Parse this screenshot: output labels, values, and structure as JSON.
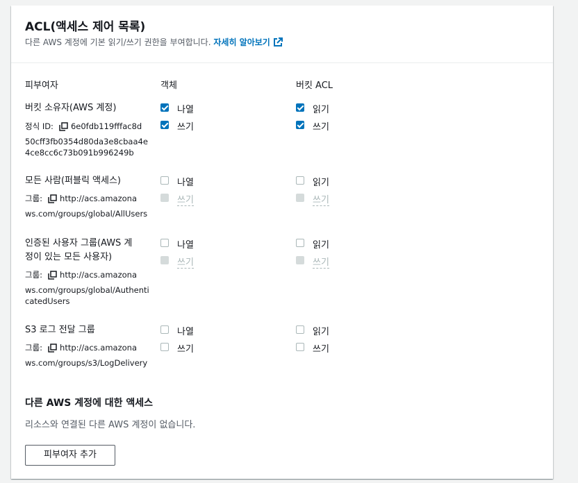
{
  "header": {
    "title": "ACL(액세스 제어 목록)",
    "description": "다른 AWS 계정에 기본 읽기/쓰기 권한을 부여합니다.",
    "learn_more": "자세히 알아보기"
  },
  "columns": {
    "grantee": "피부여자",
    "object": "객체",
    "bucket_acl": "버킷 ACL"
  },
  "grantees": [
    {
      "name": "버킷 소유자(AWS 계정)",
      "id_label": "정식 ID:",
      "id_lines": [
        "6e0fdb119fffac8d",
        "50cff3fb0354d80da3e8cbaa4e",
        "4ce8cc6c73b091b996249b"
      ],
      "object": {
        "list_label": "나열",
        "list_checked": true,
        "write_label": "쓰기",
        "write_checked": true,
        "write_disabled": false
      },
      "acl": {
        "read_label": "읽기",
        "read_checked": true,
        "write_label": "쓰기",
        "write_checked": true,
        "write_disabled": false
      }
    },
    {
      "name": "모든 사람(퍼블릭 액세스)",
      "id_label": "그룹:",
      "id_lines": [
        "http://acs.amazona",
        "ws.com/groups/global/AllUsers"
      ],
      "object": {
        "list_label": "나열",
        "list_checked": false,
        "write_label": "쓰기",
        "write_checked": false,
        "write_disabled": true
      },
      "acl": {
        "read_label": "읽기",
        "read_checked": false,
        "write_label": "쓰기",
        "write_checked": false,
        "write_disabled": true
      }
    },
    {
      "name_lines": [
        "인증된 사용자 그룹(AWS 계",
        "정이 있는 모든 사용자)"
      ],
      "id_label": "그룹:",
      "id_lines": [
        "http://acs.amazona",
        "ws.com/groups/global/Authenti",
        "catedUsers"
      ],
      "object": {
        "list_label": "나열",
        "list_checked": false,
        "write_label": "쓰기",
        "write_checked": false,
        "write_disabled": true
      },
      "acl": {
        "read_label": "읽기",
        "read_checked": false,
        "write_label": "쓰기",
        "write_checked": false,
        "write_disabled": true
      }
    },
    {
      "name": "S3 로그 전달 그룹",
      "id_label": "그룹:",
      "id_lines": [
        "http://acs.amazona",
        "ws.com/groups/s3/LogDelivery"
      ],
      "object": {
        "list_label": "나열",
        "list_checked": false,
        "write_label": "쓰기",
        "write_checked": false,
        "write_disabled": false
      },
      "acl": {
        "read_label": "읽기",
        "read_checked": false,
        "write_label": "쓰기",
        "write_checked": false,
        "write_disabled": false
      }
    }
  ],
  "other_accounts": {
    "title": "다른 AWS 계정에 대한 액세스",
    "description": "리소스와 연결된 다른 AWS 계정이 없습니다.",
    "add_button": "피부여자 추가"
  },
  "colors": {
    "accent": "#0073bb",
    "disabled": "#aab7b8",
    "muted_text": "#545b64"
  }
}
